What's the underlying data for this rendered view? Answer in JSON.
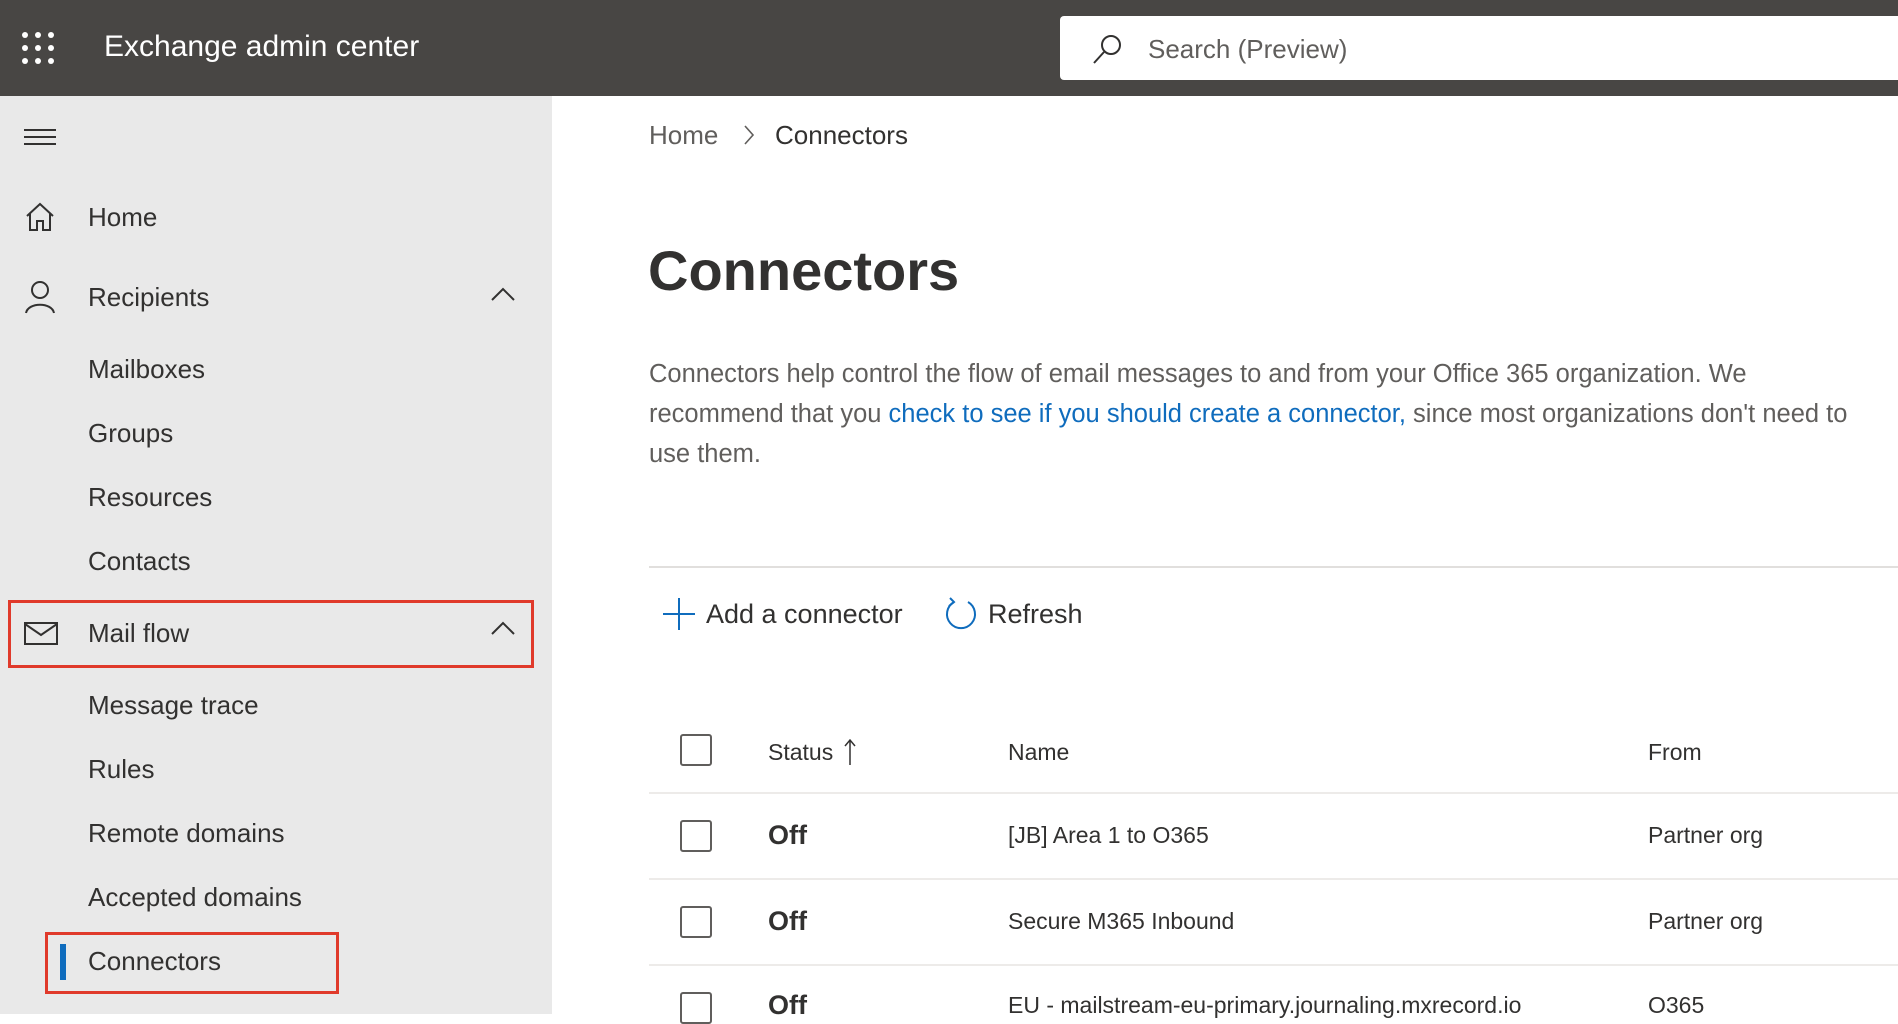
{
  "header": {
    "title": "Exchange admin center",
    "search_placeholder": "Search (Preview)"
  },
  "sidebar": {
    "items": [
      {
        "label": "Home"
      },
      {
        "label": "Recipients"
      },
      {
        "label": "Mailboxes"
      },
      {
        "label": "Groups"
      },
      {
        "label": "Resources"
      },
      {
        "label": "Contacts"
      },
      {
        "label": "Mail flow"
      },
      {
        "label": "Message trace"
      },
      {
        "label": "Rules"
      },
      {
        "label": "Remote domains"
      },
      {
        "label": "Accepted domains"
      },
      {
        "label": "Connectors"
      }
    ]
  },
  "breadcrumb": {
    "home": "Home",
    "current": "Connectors"
  },
  "page": {
    "title": "Connectors",
    "desc_before": "Connectors help control the flow of email messages to and from your Office 365 organization. We recommend that you ",
    "desc_link": "check to see if you should create a connector,",
    "desc_after": " since most organizations don't need to use them."
  },
  "toolbar": {
    "add": "Add a connector",
    "refresh": "Refresh"
  },
  "table": {
    "columns": [
      "Status",
      "Name",
      "From"
    ],
    "rows": [
      {
        "status": "Off",
        "name": "[JB] Area 1 to O365",
        "from": "Partner org"
      },
      {
        "status": "Off",
        "name": "Secure M365 Inbound",
        "from": "Partner org"
      },
      {
        "status": "Off",
        "name": "EU - mailstream-eu-primary.journaling.mxrecord.io",
        "from": "O365"
      }
    ]
  },
  "colors": {
    "accent": "#0f6cbd",
    "highlight": "#e03a2b"
  }
}
